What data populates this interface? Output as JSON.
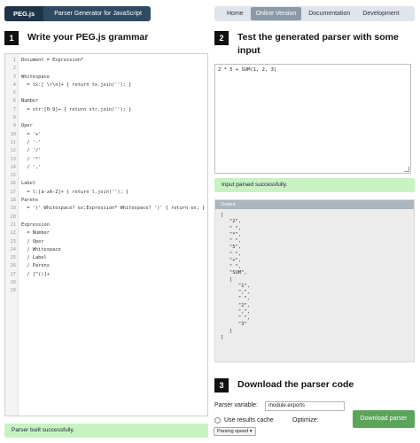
{
  "header": {
    "logo": "PEG.js",
    "tagline": "Parser Generator for JavaScript",
    "nav": [
      {
        "label": "Home",
        "active": false
      },
      {
        "label": "Online Version",
        "active": true
      },
      {
        "label": "Documentation",
        "active": false
      },
      {
        "label": "Development",
        "active": false
      }
    ]
  },
  "step1": {
    "number": "1",
    "title": "Write your PEG.js grammar"
  },
  "grammar": {
    "lines": [
      {
        "n": "1",
        "code": "Document = Expression*"
      },
      {
        "n": "2",
        "code": ""
      },
      {
        "n": "3",
        "code": "Whitespace"
      },
      {
        "n": "4",
        "code": "  = tx:[ \\r\\n]+ { return tx.join(''); }"
      },
      {
        "n": "5",
        "code": ""
      },
      {
        "n": "6",
        "code": "Number"
      },
      {
        "n": "7",
        "code": "  = str:[0-9]+ { return str.join(''); }"
      },
      {
        "n": "8",
        "code": ""
      },
      {
        "n": "9",
        "code": "Oper"
      },
      {
        "n": "10",
        "code": "  = '+'"
      },
      {
        "n": "11",
        "code": "  / '-'"
      },
      {
        "n": "12",
        "code": "  / '/'"
      },
      {
        "n": "13",
        "code": "  / '*'"
      },
      {
        "n": "14",
        "code": "  / ','"
      },
      {
        "n": "15",
        "code": ""
      },
      {
        "n": "16",
        "code": "Label"
      },
      {
        "n": "17",
        "code": "  = l:[a-zA-Z]+ { return l.join(''); }"
      },
      {
        "n": "18",
        "code": "Parens"
      },
      {
        "n": "19",
        "code": "  = '(' Whitespace? ex:Expression* Whitespace? ')' { return ex; }"
      },
      {
        "n": "20",
        "code": ""
      },
      {
        "n": "21",
        "code": "Expression"
      },
      {
        "n": "22",
        "code": "  = Number"
      },
      {
        "n": "23",
        "code": "  / Oper"
      },
      {
        "n": "24",
        "code": "  / Whitespace"
      },
      {
        "n": "25",
        "code": "  / Label"
      },
      {
        "n": "26",
        "code": "  / Parens"
      },
      {
        "n": "27",
        "code": "  / [^()]+"
      },
      {
        "n": "28",
        "code": ""
      },
      {
        "n": "29",
        "code": ""
      }
    ]
  },
  "status_left": "Parser built successfully.",
  "step2": {
    "number": "2",
    "title": "Test the generated parser with some input"
  },
  "test_input": "2 * 5 + SUM(1, 2, 3)",
  "status_right": "Input parsed successfully.",
  "output": {
    "header": "Output",
    "text": "[\n   \"2\",\n   \" \",\n   \"*\",\n   \" \",\n   \"5\",\n   \" \",\n   \"+\",\n   \" \",\n   \"SUM\",\n   [\n      \"1\",\n      \",\",\n      \" \",\n      \"2\",\n      \",\",\n      \" \",\n      \"3\"\n   ]\n]"
  },
  "step3": {
    "number": "3",
    "title": "Download the parser code"
  },
  "download": {
    "parser_variable_label": "Parser variable:",
    "parser_variable_value": "module.exports",
    "cache_label": "Use results cache",
    "optimize_label": "Optimize:",
    "optimize_value": "Parsing speed ▾",
    "button_label": "Download parser"
  }
}
